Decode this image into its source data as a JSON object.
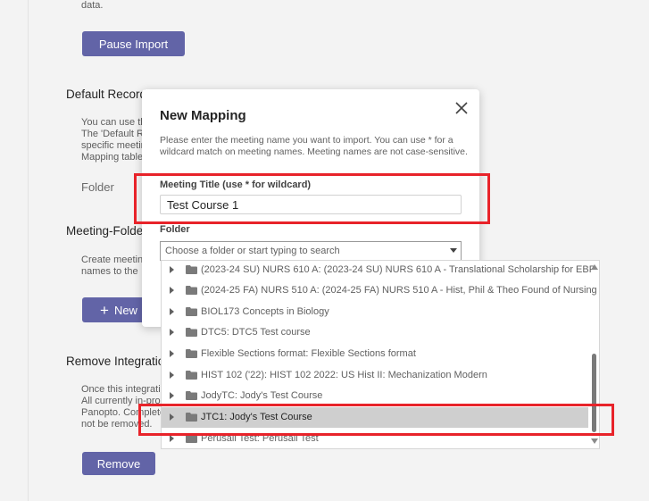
{
  "background": {
    "top_text": "data.",
    "pause_button": "Pause Import",
    "default_section_title": "Default Record",
    "default_section_text": [
      "You can use th",
      "The 'Default R",
      "specific meetin",
      "Mapping table"
    ],
    "default_folder_label": "Folder",
    "meeting_folder_title": "Meeting-Folde",
    "meeting_folder_text": [
      "Create meetin",
      "names to the"
    ],
    "new_button": "New",
    "remove_section_title": "Remove Integratio",
    "remove_section_text": [
      "Once this integrati",
      "All currently in-pro",
      "Panopto. Complete",
      "not be removed."
    ],
    "remove_button": "Remove"
  },
  "dialog": {
    "title": "New Mapping",
    "description": "Please enter the meeting name you want to import. You can use * for a wildcard match on meeting names. Meeting names are not case-sensitive.",
    "meeting_title_label": "Meeting Title (use * for wildcard)",
    "meeting_title_value": "Test Course 1",
    "folder_label": "Folder",
    "folder_placeholder": "Choose a folder or start typing to search"
  },
  "folder_list": [
    {
      "label": "(2023-24 SU) NURS 610 A: (2023-24 SU) NURS 610 A - Translational Scholarship for EBP",
      "selected": false
    },
    {
      "label": "(2024-25 FA) NURS 510 A: (2024-25 FA) NURS 510 A - Hist, Phil & Theo Found of Nursing",
      "selected": false
    },
    {
      "label": "BIOL173 Concepts in Biology",
      "selected": false
    },
    {
      "label": "DTC5: DTC5 Test course",
      "selected": false
    },
    {
      "label": "Flexible Sections format: Flexible Sections format",
      "selected": false
    },
    {
      "label": "HIST 102 ('22): HIST 102 2022: US Hist II: Mechanization Modern",
      "selected": false
    },
    {
      "label": "JodyTC: Jody's Test Course",
      "selected": false
    },
    {
      "label": "JTC1: Jody's Test Course",
      "selected": true
    },
    {
      "label": "Perusall Test: Perusall Test",
      "selected": false
    }
  ],
  "colors": {
    "accent": "#6264a7",
    "highlight": "#e8232a",
    "selected_row": "#cfcfcf"
  }
}
